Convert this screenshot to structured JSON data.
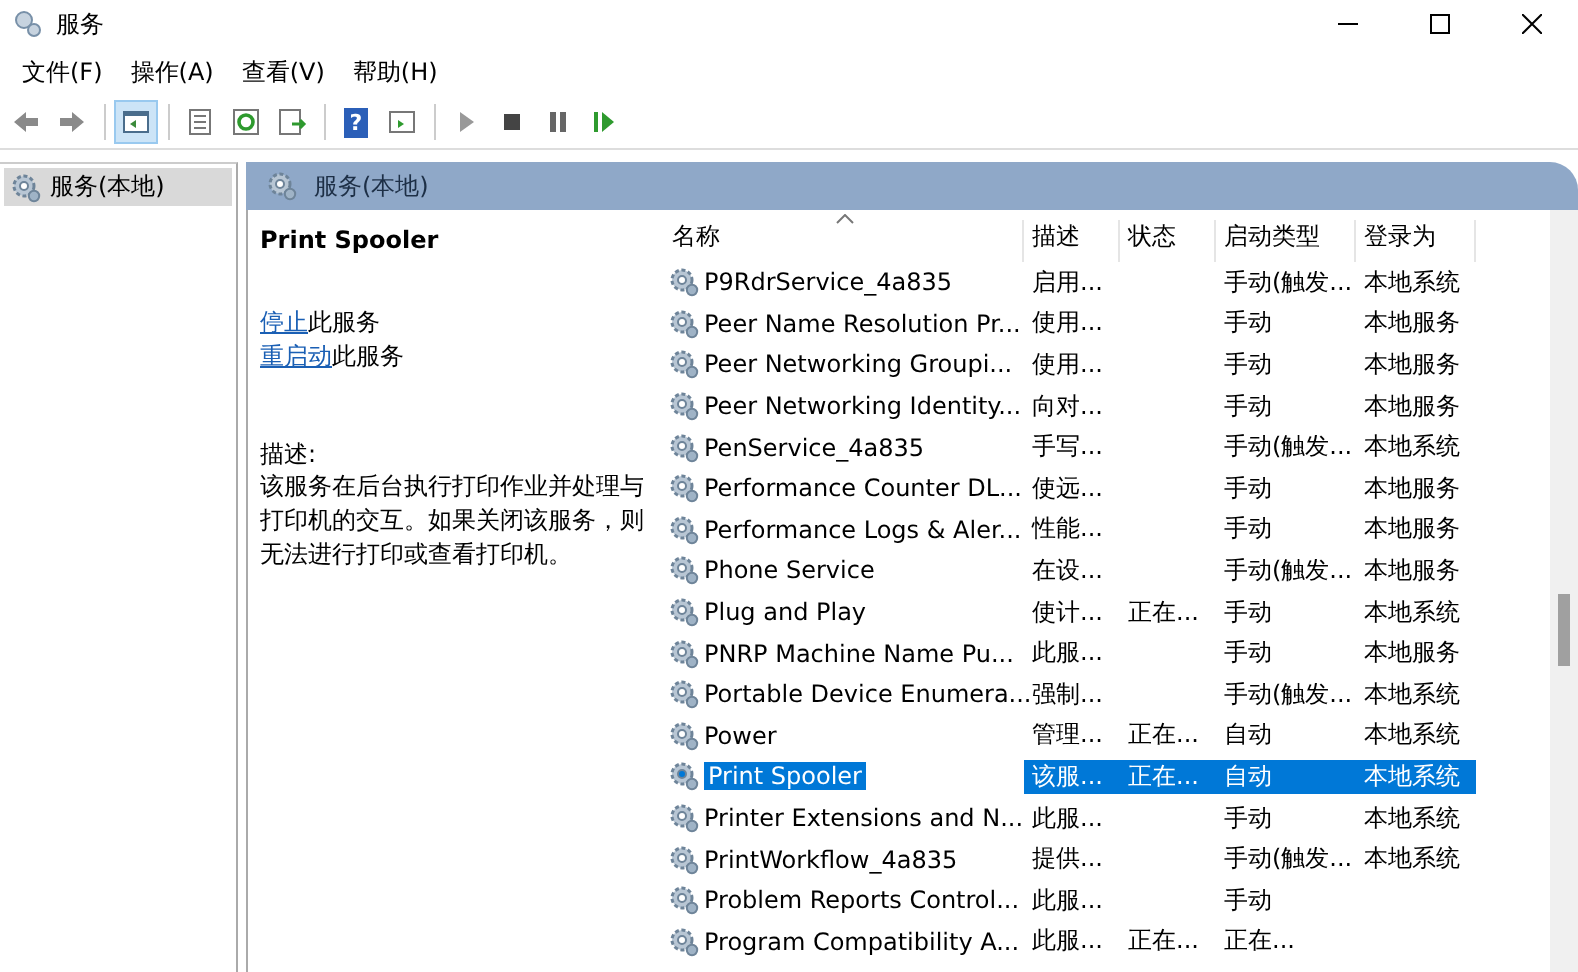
{
  "window": {
    "title": "服务"
  },
  "menu": [
    {
      "label": "文件(F)"
    },
    {
      "label": "操作(A)"
    },
    {
      "label": "查看(V)"
    },
    {
      "label": "帮助(H)"
    }
  ],
  "toolbar": [
    {
      "kind": "back",
      "selected": false
    },
    {
      "kind": "forward",
      "selected": false
    },
    {
      "kind": "sep"
    },
    {
      "kind": "tree",
      "selected": true
    },
    {
      "kind": "sep"
    },
    {
      "kind": "properties",
      "selected": false
    },
    {
      "kind": "refresh",
      "selected": false
    },
    {
      "kind": "export",
      "selected": false
    },
    {
      "kind": "sep"
    },
    {
      "kind": "help",
      "glyph": "?",
      "selected": false
    },
    {
      "kind": "view",
      "selected": false
    },
    {
      "kind": "sep"
    },
    {
      "kind": "play",
      "selected": false
    },
    {
      "kind": "stop",
      "selected": false
    },
    {
      "kind": "pause",
      "selected": false
    },
    {
      "kind": "resume",
      "selected": false
    }
  ],
  "tree": {
    "items": [
      {
        "label": "服务(本地)",
        "selected": true
      }
    ]
  },
  "panel_header": {
    "title": "服务(本地)"
  },
  "details": {
    "title": "Print Spooler",
    "actions": [
      {
        "link": "停止",
        "text": "此服务"
      },
      {
        "link": "重启动",
        "text": "此服务"
      }
    ],
    "description_label": "描述:",
    "description": "该服务在后台执行打印作业并处理与打印机的交互。如果关闭该服务，则无法进行打印或查看打印机。"
  },
  "table": {
    "columns": [
      "名称",
      "描述",
      "状态",
      "启动类型",
      "登录为"
    ],
    "rows": [
      {
        "name": "P9RdrService_4a835",
        "desc": "启用...",
        "startup": "手动(触发...",
        "logon": "本地系统",
        "selected": false
      },
      {
        "name": "Peer Name Resolution Pr...",
        "desc": "使用...",
        "startup": "手动",
        "logon": "本地服务",
        "selected": false
      },
      {
        "name": "Peer Networking Groupi...",
        "desc": "使用...",
        "startup": "手动",
        "logon": "本地服务",
        "selected": false
      },
      {
        "name": "Peer Networking Identity...",
        "desc": "向对...",
        "startup": "手动",
        "logon": "本地服务",
        "selected": false
      },
      {
        "name": "PenService_4a835",
        "desc": "手写...",
        "startup": "手动(触发...",
        "logon": "本地系统",
        "selected": false
      },
      {
        "name": "Performance Counter DL...",
        "desc": "使远...",
        "startup": "手动",
        "logon": "本地服务",
        "selected": false
      },
      {
        "name": "Performance Logs & Aler...",
        "desc": "性能...",
        "startup": "手动",
        "logon": "本地服务",
        "selected": false
      },
      {
        "name": "Phone Service",
        "desc": "在设...",
        "startup": "手动(触发...",
        "logon": "本地服务",
        "selected": false
      },
      {
        "name": "Plug and Play",
        "desc": "使计...",
        "status": "正在...",
        "startup": "手动",
        "logon": "本地系统",
        "selected": false
      },
      {
        "name": "PNRP Machine Name Pu...",
        "desc": "此服...",
        "startup": "手动",
        "logon": "本地服务",
        "selected": false
      },
      {
        "name": "Portable Device Enumera...",
        "desc": "强制...",
        "startup": "手动(触发...",
        "logon": "本地系统",
        "selected": false
      },
      {
        "name": "Power",
        "desc": "管理...",
        "status": "正在...",
        "startup": "自动",
        "logon": "本地系统",
        "selected": false
      },
      {
        "name": "Print Spooler",
        "desc": "该服...",
        "status": "正在...",
        "startup": "自动",
        "logon": "本地系统",
        "selected": true
      },
      {
        "name": "Printer Extensions and N...",
        "desc": "此服...",
        "startup": "手动",
        "logon": "本地系统",
        "selected": false
      },
      {
        "name": "PrintWorkflow_4a835",
        "desc": "提供...",
        "startup": "手动(触发...",
        "logon": "本地系统",
        "selected": false
      },
      {
        "name": "Problem Reports Control...",
        "desc": "此服...",
        "startup": "手动",
        "selected": false
      },
      {
        "name": "Program Compatibility A...",
        "desc": "此服...",
        "status": "正在...",
        "startup": "正在...",
        "selected": false
      }
    ]
  }
}
